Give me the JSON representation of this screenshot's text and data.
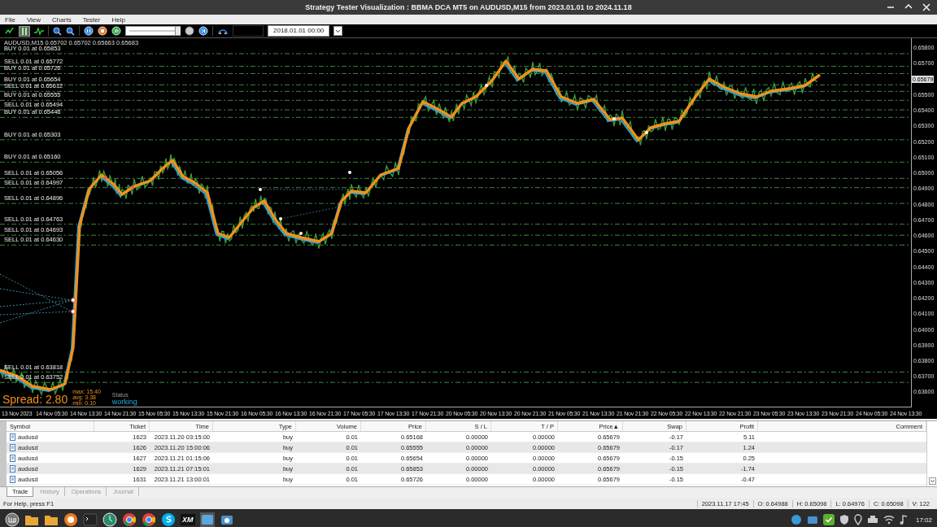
{
  "window": {
    "title": "Strategy Tester Visualization : BBMA DCA MT5 on AUDUSD,M15 from 2023.01.01 to 2024.11.18"
  },
  "menu": [
    "File",
    "View",
    "Charts",
    "Tester",
    "Help"
  ],
  "toolbar": {
    "pause": {
      "selected": true
    },
    "speed": {
      "level": 1
    },
    "date": "2018.01.01 00:00"
  },
  "chart": {
    "header": "AUDUSD,M15  0.65702 0.65702 0.65663 0.65683",
    "orders": [
      {
        "label": "BUY 0.01 at 0.65853"
      },
      {
        "label": "SELL 0.01 at 0.65772"
      },
      {
        "label": "BUY 0.01 at 0.65726"
      },
      {
        "label": "BUY 0.01 at 0.65654"
      },
      {
        "label": "SELL 0.01 at 0.65612"
      },
      {
        "label": "BUY 0.01 at 0.65555"
      },
      {
        "label": "SELL 0.01 at 0.65494"
      },
      {
        "label": "BUY 0.01 at 0.65446"
      },
      {
        "label": "BUY 0.01 at 0.65303"
      },
      {
        "label": "BUY 0.01 at 0.65160"
      },
      {
        "label": "SELL 0.01 at 0.65056"
      },
      {
        "label": "SELL 0.01 at 0.64997"
      },
      {
        "label": "SELL 0.01 at 0.64896"
      },
      {
        "label": "SELL 0.01 at 0.64763"
      },
      {
        "label": "SELL 0.01 at 0.64693"
      },
      {
        "label": "SELL 0.01 at 0.64630"
      },
      {
        "label": "SELL 0.01 at 0.63818"
      },
      {
        "label": "SELL 0.01 at 0.63752"
      }
    ],
    "y_labels": [
      "0.65800",
      "0.65700",
      "0.65500",
      "0.65400",
      "0.65300",
      "0.65200",
      "0.65100",
      "0.65000",
      "0.64900",
      "0.64800",
      "0.64700",
      "0.64600",
      "0.64500",
      "0.64400",
      "0.64300",
      "0.64200",
      "0.64100",
      "0.64000",
      "0.63900",
      "0.63800",
      "0.63700",
      "0.63600"
    ],
    "current_price": "0.65679",
    "x_labels": [
      "13 Nov 2023",
      "14 Nov 05:30",
      "14 Nov 13:30",
      "14 Nov 21:30",
      "15 Nov 05:30",
      "15 Nov 13:30",
      "15 Nov 21:30",
      "16 Nov 05:30",
      "16 Nov 13:30",
      "16 Nov 21:30",
      "17 Nov 05:30",
      "17 Nov 13:30",
      "17 Nov 21:30",
      "20 Nov 05:30",
      "20 Nov 13:30",
      "20 Nov 21:30",
      "21 Nov 05:30",
      "21 Nov 13:30",
      "21 Nov 21:30",
      "22 Nov 05:30",
      "22 Nov 13:30",
      "22 Nov 21:30",
      "23 Nov 05:30",
      "23 Nov 13:30",
      "23 Nov 21:30",
      "24 Nov 05:30",
      "24 Nov 13:30"
    ],
    "spread": {
      "label": "Spread: 2.80",
      "max": "max: 15.40",
      "avg": "avg: 3.38",
      "min": "min: 0.10",
      "status_label": "Status",
      "status": "working"
    }
  },
  "table": {
    "columns": [
      {
        "label": "Symbol",
        "sorted": false
      },
      {
        "label": "Ticket",
        "sorted": false
      },
      {
        "label": "Time",
        "sorted": false
      },
      {
        "label": "Type",
        "sorted": false
      },
      {
        "label": "Volume",
        "sorted": false
      },
      {
        "label": "Price",
        "sorted": false
      },
      {
        "label": "S / L",
        "sorted": false
      },
      {
        "label": "T / P",
        "sorted": false
      },
      {
        "label": "Price",
        "sorted": true
      },
      {
        "label": "Swap",
        "sorted": false
      },
      {
        "label": "Profit",
        "sorted": false
      },
      {
        "label": "Comment",
        "sorted": false
      }
    ],
    "sort_mark": "▲",
    "rows": [
      [
        "audusd",
        "1623",
        "2023.11.20 03:15:00",
        "buy",
        "0.01",
        "0.65168",
        "0.00000",
        "0.00000",
        "0.65679",
        "-0.17",
        "5.11"
      ],
      [
        "audusd",
        "1626",
        "2023.11.20 15:00:06",
        "buy",
        "0.01",
        "0.65555",
        "0.00000",
        "0.00000",
        "0.65679",
        "-0.17",
        "1.24"
      ],
      [
        "audusd",
        "1627",
        "2023.11.21 01:15:06",
        "buy",
        "0.01",
        "0.65654",
        "0.00000",
        "0.00000",
        "0.65679",
        "-0.15",
        "0.25"
      ],
      [
        "audusd",
        "1629",
        "2023.11.21 07:15:01",
        "buy",
        "0.01",
        "0.65853",
        "0.00000",
        "0.00000",
        "0.65679",
        "-0.15",
        "-1.74"
      ],
      [
        "audusd",
        "1631",
        "2023.11.21 13:00:01",
        "buy",
        "0.01",
        "0.65726",
        "0.00000",
        "0.00000",
        "0.65679",
        "-0.15",
        "-0.47"
      ]
    ]
  },
  "tabs": [
    {
      "label": "Trade",
      "selected": true
    },
    {
      "label": "History",
      "selected": false
    },
    {
      "label": "Operations",
      "selected": false
    },
    {
      "label": "Journal",
      "selected": false
    }
  ],
  "status_bar": {
    "help": "For Help, press F1",
    "fields": [
      "2023.11.17 17:45",
      "O: 0.64988",
      "H: 0.65098",
      "L: 0.64976",
      "C: 0.65098",
      "V: 122"
    ]
  },
  "taskbar": {
    "apps": [
      {
        "kind": "folder"
      },
      {
        "kind": "folder"
      },
      {
        "kind": "browser-orange"
      },
      {
        "kind": "terminal"
      },
      {
        "kind": "clock"
      },
      {
        "kind": "chrome"
      },
      {
        "kind": "chrome"
      },
      {
        "kind": "skype"
      },
      {
        "kind": "xm",
        "label": "XM"
      },
      {
        "kind": "window"
      },
      {
        "kind": "camera"
      }
    ],
    "clock": "17:02"
  }
}
